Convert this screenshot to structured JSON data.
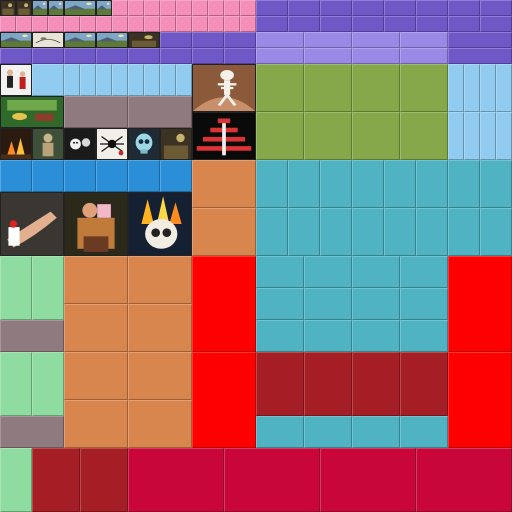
{
  "colors": {
    "pink": "#f48fb9",
    "purple": "#6f59c9",
    "lavender": "#9a8ae6",
    "light_blue": "#92cbf0",
    "blue": "#2a8fd6",
    "olive": "#86a84a",
    "teal": "#4fb3c4",
    "orange": "#d9864e",
    "mint": "#8fdca0",
    "mauve": "#8e7a7f",
    "red": "#ff0000",
    "dark_red": "#a51e25",
    "crimson": "#c8063a"
  },
  "thumbnails": [
    {
      "name": "thumb-row1-1",
      "subject": "dark-scene"
    },
    {
      "name": "thumb-row1-2",
      "subject": "dark-scene"
    },
    {
      "name": "thumb-row1-3",
      "subject": "landscape"
    },
    {
      "name": "thumb-row1-4",
      "subject": "landscape"
    },
    {
      "name": "thumb-row1-5",
      "subject": "landscape"
    },
    {
      "name": "thumb-row1-6",
      "subject": "landscape"
    },
    {
      "name": "thumb-row2-1",
      "subject": "landscape"
    },
    {
      "name": "thumb-row2-2",
      "subject": "sketch"
    },
    {
      "name": "thumb-row2-3",
      "subject": "landscape"
    },
    {
      "name": "thumb-row2-4",
      "subject": "landscape"
    },
    {
      "name": "thumb-row2-5",
      "subject": "dark-scene"
    },
    {
      "name": "thumb-figures",
      "subject": "figures"
    },
    {
      "name": "thumb-game-sprite",
      "subject": "game"
    },
    {
      "name": "thumb-fire",
      "subject": "fire"
    },
    {
      "name": "thumb-statue",
      "subject": "statue"
    },
    {
      "name": "thumb-faces",
      "subject": "faces"
    },
    {
      "name": "thumb-spider",
      "subject": "spider"
    },
    {
      "name": "thumb-skull-blue",
      "subject": "skull"
    },
    {
      "name": "thumb-misc",
      "subject": "dark-scene"
    },
    {
      "name": "thumb-skeleton-painting",
      "subject": "skeleton"
    },
    {
      "name": "thumb-pyramid-game",
      "subject": "pyramid"
    },
    {
      "name": "thumb-hand-painting",
      "subject": "hand"
    },
    {
      "name": "thumb-pink-figures",
      "subject": "pink-figures"
    },
    {
      "name": "thumb-flaming-skull",
      "subject": "flaming-skull"
    }
  ]
}
